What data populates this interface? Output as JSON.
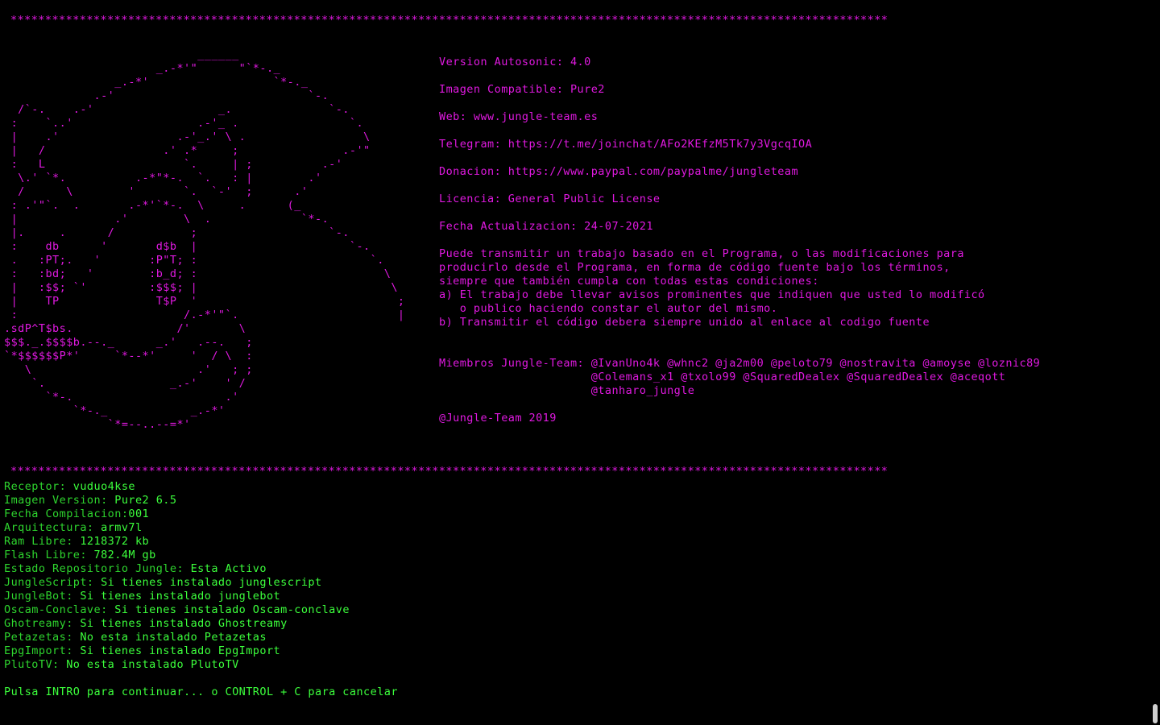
{
  "colors": {
    "background": "#000000",
    "magenta": "#e019e0",
    "green_label": "#2ed52e",
    "green_value": "#3cff3c"
  },
  "separator": "*******************************************************************************************************************************",
  "ascii_art": "                            ______\n                      _.-*'\"      \"`*-._\n                _.-*'                  `*-._\n             .-'                            `-.\n  /`-.    .-'                  _.              `-.\n :    `..'                  .-'_ .                `.\n |    .'                 .-'_.' \\ .                 \\\n |   /                 .' .*     ;               .-'\"\n :   L                    `.     | ;          .-'\n  \\.' `*.          .-*\"*-.  `.   : |        .'\n  /      \\        '       `.  `-'  ;      .'\n : .'\"`.  .       .-*'`*-.  \\     .      (_\n |              .'        \\  .             `*-.\n |.     .      /           ;                   `-.\n :    db      '       d$b  |                      `-.\n .   :PT;.   '       :P\"T; :                         `.\n :   :bd;   '        :b_d; :                           \\\n |   :$$; `'         :$$$; |                            \\\n |    TP              T$P  '                             ;\n :                        /.-*'\"`.                       |\n.sdP^T$bs.               /'       \\\n$$$._.$$$$b.--._      _.'   .--.   ;\n`*$$$$$$P*'     `*--*'     '  / \\  :\n   \\                        .'   ; ;\n    `.                  _.-'    ' /\n      `*-.                      .'\n          `*-._            _.-*'\n               `*=--..--=*'",
  "info": {
    "version": "Version Autosonic: 4.0",
    "image": "Imagen Compatible: Pure2",
    "web": "Web: www.jungle-team.es",
    "telegram": "Telegram: https://t.me/joinchat/AFo2KEfzM5Tk7y3VgcqIOA",
    "donation": "Donacion: https://www.paypal.com/paypalme/jungleteam",
    "license": "Licencia: General Public License",
    "update_date": "Fecha Actualizacion: 24-07-2021",
    "license_text": [
      "Puede transmitir un trabajo basado en el Programa, o las modificaciones para",
      "producirlo desde el Programa, en forma de código fuente bajo los términos,",
      "siempre que también cumpla con todas estas condiciones:",
      "a) El trabajo debe llevar avisos prominentes que indiquen que usted lo modificó",
      "   o publico haciendo constar el autor del mismo.",
      "b) Transmitir el código debera siempre unido al enlace al codigo fuente"
    ],
    "members": [
      "Miembros Jungle-Team: @IvanUno4k @whnc2 @ja2m00 @peloto79 @nostravita @amoyse @loznic89",
      "                      @Colemans_x1 @txolo99 @SquaredDealex @SquaredDealex @aceqott",
      "                      @tanharo_jungle"
    ],
    "copyright": "@Jungle-Team 2019"
  },
  "status": [
    {
      "label": "Receptor: ",
      "value": "vuduo4kse"
    },
    {
      "label": "Imagen Version: ",
      "value": "Pure2 6.5"
    },
    {
      "label": "Fecha Compilacion:",
      "value": "001"
    },
    {
      "label": "Arquitectura: ",
      "value": "armv7l"
    },
    {
      "label": "Ram Libre: ",
      "value": "1218372 kb"
    },
    {
      "label": "Flash Libre: ",
      "value": "782.4M gb"
    },
    {
      "label": "Estado Repositorio Jungle: ",
      "value": "Esta Activo"
    },
    {
      "label": "JungleScript: ",
      "value": "Si tienes instalado junglescript"
    },
    {
      "label": "JungleBot: ",
      "value": "Si tienes instalado junglebot"
    },
    {
      "label": "Oscam-Conclave: ",
      "value": "Si tienes instalado Oscam-conclave"
    },
    {
      "label": "Ghotreamy: ",
      "value": "Si tienes instalado Ghostreamy"
    },
    {
      "label": "Petazetas: ",
      "value": "No esta instalado Petazetas"
    },
    {
      "label": "EpgImport: ",
      "value": "Si tienes instalado EpgImport"
    },
    {
      "label": "PlutoTV: ",
      "value": "No esta instalado PlutoTV"
    }
  ],
  "prompt": "Pulsa INTRO para continuar... o CONTROL + C para cancelar"
}
